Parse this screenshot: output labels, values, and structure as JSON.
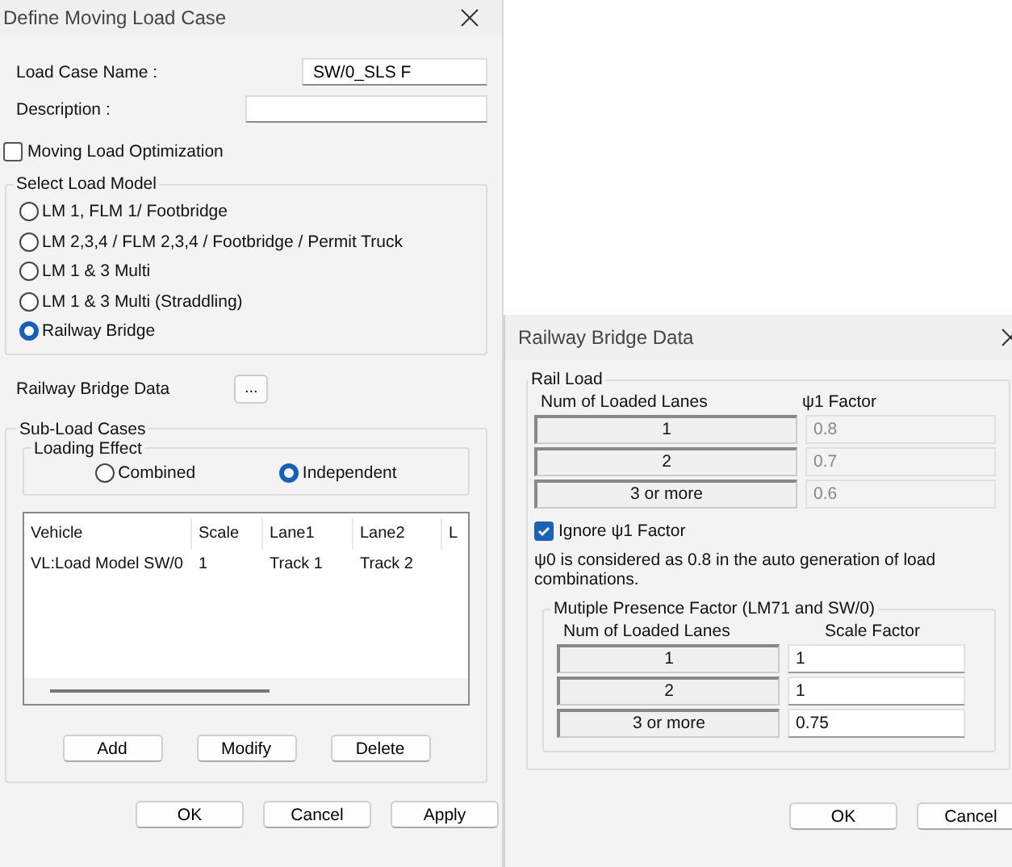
{
  "main_dialog": {
    "title": "Define Moving Load Case",
    "fields": [
      {
        "label": "Load Case Name  :",
        "value": "SW/0_SLS F"
      },
      {
        "label": "Description :"
      }
    ],
    "optimization": {
      "label": "Moving Load Optimization",
      "checked": false
    },
    "load_model": {
      "title": "Select Load Model",
      "options": [
        {
          "label": "LM 1, FLM 1/ Footbridge",
          "selected": false
        },
        {
          "label": "LM 2,3,4 / FLM 2,3,4 / Footbridge / Permit Truck",
          "selected": false
        },
        {
          "label": "LM 1 & 3 Multi",
          "selected": false
        },
        {
          "label": "LM 1 & 3 Multi (Straddling)",
          "selected": false
        },
        {
          "label": "Railway Bridge",
          "selected": true
        }
      ]
    },
    "railway_data": {
      "label": "Railway Bridge Data",
      "button": "..."
    },
    "sub_load_cases": {
      "title": "Sub-Load Cases",
      "loading_effect": {
        "title": "Loading Effect",
        "options": [
          {
            "label": "Combined",
            "selected": false
          },
          {
            "label": "Independent",
            "selected": true
          }
        ]
      },
      "table": {
        "columns": [
          "Vehicle",
          "Scale",
          "Lane1",
          "Lane2",
          "L"
        ],
        "rows": [
          [
            "VL:Load Model SW/0",
            "1",
            "Track 1",
            "Track 2"
          ]
        ]
      },
      "buttons": [
        "Add",
        "Modify",
        "Delete"
      ]
    },
    "buttons": [
      "OK",
      "Cancel",
      "Apply"
    ]
  },
  "railway_dialog": {
    "title": "Railway Bridge Data",
    "rail_load": {
      "title": "Rail Load",
      "columns": [
        "Num of Loaded Lanes",
        "ψ1 Factor"
      ],
      "rows": [
        {
          "lanes": "1",
          "factor": "0.8",
          "disabled": true
        },
        {
          "lanes": "2",
          "factor": "0.7",
          "disabled": true
        },
        {
          "lanes": "3 or more",
          "factor": "0.6",
          "disabled": true
        }
      ],
      "ignore": {
        "label": "Ignore ψ1 Factor",
        "checked": true
      },
      "note": "ψ0 is considered as 0.8 in the auto generation of load combinations.",
      "presence": {
        "title": "Mutiple Presence Factor (LM71 and SW/0)",
        "columns": [
          "Num of Loaded Lanes",
          "Scale Factor"
        ],
        "rows": [
          {
            "lanes": "1",
            "factor": "1",
            "disabled": false
          },
          {
            "lanes": "2",
            "factor": "1",
            "disabled": false
          },
          {
            "lanes": "3 or more",
            "factor": "0.75",
            "disabled": false
          }
        ]
      }
    },
    "buttons": [
      "OK",
      "Cancel"
    ]
  }
}
